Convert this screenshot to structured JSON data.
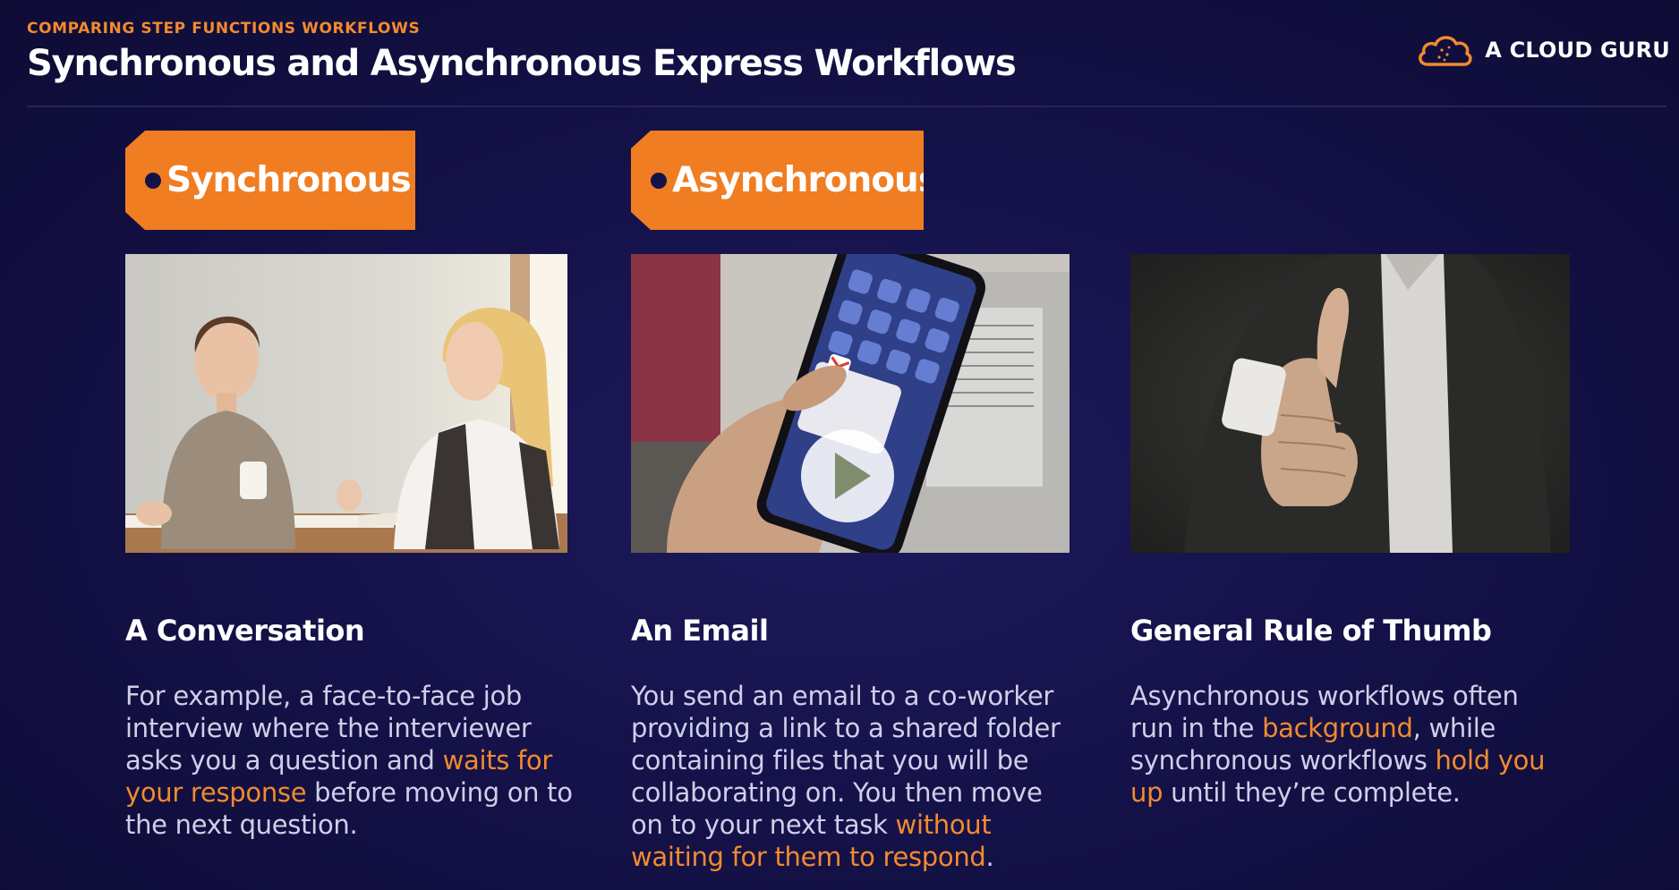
{
  "header": {
    "subtitle": "COMPARING STEP FUNCTIONS WORKFLOWS",
    "title": "Synchronous and Asynchronous Express Workflows"
  },
  "brand": {
    "name": "A CLOUD GURU",
    "icon": "cloud-icon"
  },
  "colors": {
    "accent": "#f07d22",
    "background": "#15124a",
    "body_text": "#cfcfe8"
  },
  "columns": [
    {
      "tag": "Synchronous",
      "photo": "two-women-conversation-photo",
      "heading": "A Conversation",
      "body": {
        "part1": "For example, a face-to-face job interview where the interviewer asks you a question and ",
        "highlight1": "waits for your response",
        "part2": " before moving on to the next question."
      }
    },
    {
      "tag": "Asynchronous",
      "photo": "hand-holding-phone-email-photo",
      "heading": "An Email",
      "body": {
        "part1": "You send an email to a co-worker providing a link to a shared folder containing files that you will be collaborating on. You then move on to your next task ",
        "highlight1": "without waiting for them to respond",
        "part2": "."
      }
    },
    {
      "photo": "thumbs-up-photo",
      "heading": "General Rule of Thumb",
      "body": {
        "part1": "Asynchronous workflows often run in the ",
        "highlight1": "background",
        "part2": ", while synchronous workflows ",
        "highlight2": "hold you up",
        "part3": " until they’re complete."
      }
    }
  ]
}
